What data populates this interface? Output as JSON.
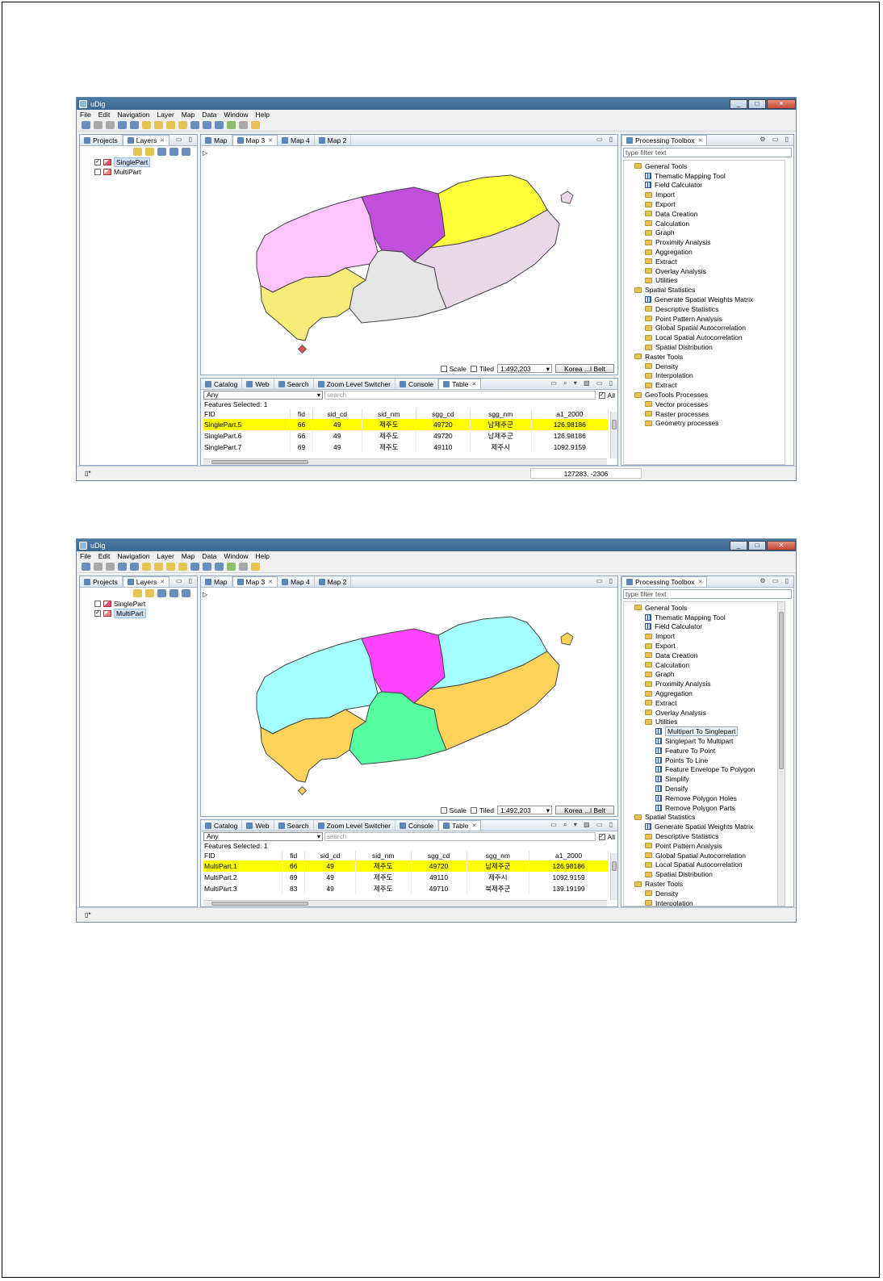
{
  "windows": [
    {
      "title": "uDig",
      "window_controls": [
        "_",
        "□",
        "✕"
      ],
      "menu": [
        "File",
        "Edit",
        "Navigation",
        "Layer",
        "Map",
        "Data",
        "Window",
        "Help"
      ],
      "left_tabs": [
        "Projects",
        "Layers"
      ],
      "layers": [
        {
          "name": "SinglePart",
          "checked": true,
          "selected": true
        },
        {
          "name": "MultiPart",
          "checked": false,
          "selected": false
        }
      ],
      "map_tabs": [
        "Map",
        "Map 3",
        "Map 4",
        "Map 2"
      ],
      "active_map_tab": 1,
      "map_colors": {
        "z1": "#ffc4ff",
        "z2": "#c050dc",
        "z3": "#ffff3a",
        "z4": "#ead8ea",
        "z5": "#e6e6e6",
        "z6": "#f6ec78",
        "islet": "#e05050"
      },
      "map_bottom": {
        "scale_label": "Scale",
        "tiled_label": "Tiled",
        "scale_value": "1:492,203",
        "crs_button": "Korea ...l Belt"
      },
      "bottom_tabs": [
        "Catalog",
        "Web",
        "Search",
        "Zoom Level Switcher",
        "Console",
        "Table"
      ],
      "filter_select": "Any",
      "search_placeholder": "search",
      "all_label": "All",
      "features_selected": "Features Selected: 1",
      "table_columns": [
        "FID",
        "fid",
        "sid_cd",
        "sid_nm",
        "sgg_cd",
        "sgg_nm",
        "a1_2000"
      ],
      "table_rows": [
        [
          "SinglePart.5",
          "66",
          "49",
          "제주도",
          "49720",
          "남제주군",
          "126.98186"
        ],
        [
          "SinglePart.6",
          "66",
          "49",
          "제주도",
          "49720",
          "남제주군",
          "126.98186"
        ],
        [
          "SinglePart.7",
          "69",
          "49",
          "제주도",
          "49110",
          "제주시",
          "1092.9159"
        ]
      ],
      "coords": "127283, -2306",
      "toolbox_title": "Processing Toolbox",
      "toolbox_filter": "type filter text",
      "toolbox_items": [
        {
          "l": 1,
          "t": "folder",
          "s": "General Tools"
        },
        {
          "l": 2,
          "t": "tool",
          "s": "Thematic Mapping Tool"
        },
        {
          "l": 2,
          "t": "tool",
          "s": "Field Calculator"
        },
        {
          "l": 2,
          "t": "folder",
          "s": "Import"
        },
        {
          "l": 2,
          "t": "folder",
          "s": "Export"
        },
        {
          "l": 2,
          "t": "folder",
          "s": "Data Creation"
        },
        {
          "l": 2,
          "t": "folder",
          "s": "Calculation"
        },
        {
          "l": 2,
          "t": "folder",
          "s": "Graph"
        },
        {
          "l": 2,
          "t": "folder",
          "s": "Proximity Analysis"
        },
        {
          "l": 2,
          "t": "folder",
          "s": "Aggregation"
        },
        {
          "l": 2,
          "t": "folder",
          "s": "Extract"
        },
        {
          "l": 2,
          "t": "folder",
          "s": "Overlay Analysis"
        },
        {
          "l": 2,
          "t": "folder",
          "s": "Utilities"
        },
        {
          "l": 1,
          "t": "folder",
          "s": "Spatial Statistics"
        },
        {
          "l": 2,
          "t": "tool",
          "s": "Generate Spatial Weights Matrix"
        },
        {
          "l": 2,
          "t": "folder",
          "s": "Descriptive Statistics"
        },
        {
          "l": 2,
          "t": "folder",
          "s": "Point Pattern Analysis"
        },
        {
          "l": 2,
          "t": "folder",
          "s": "Global Spatial Autocorrelation"
        },
        {
          "l": 2,
          "t": "folder",
          "s": "Local Spatial Autocorrelation"
        },
        {
          "l": 2,
          "t": "folder",
          "s": "Spatial Distribution"
        },
        {
          "l": 1,
          "t": "folder",
          "s": "Raster Tools"
        },
        {
          "l": 2,
          "t": "folder",
          "s": "Density"
        },
        {
          "l": 2,
          "t": "folder",
          "s": "Interpolation"
        },
        {
          "l": 2,
          "t": "folder",
          "s": "Extract"
        },
        {
          "l": 1,
          "t": "folder",
          "s": "GeoTools Processes"
        },
        {
          "l": 2,
          "t": "folder",
          "s": "Vector processes"
        },
        {
          "l": 2,
          "t": "folder",
          "s": "Raster processes"
        },
        {
          "l": 2,
          "t": "folder",
          "s": "Geometry processes"
        }
      ]
    },
    {
      "title": "uDig",
      "window_controls": [
        "_",
        "□",
        "✕"
      ],
      "menu": [
        "File",
        "Edit",
        "Navigation",
        "Layer",
        "Map",
        "Data",
        "Window",
        "Help"
      ],
      "left_tabs": [
        "Projects",
        "Layers"
      ],
      "layers": [
        {
          "name": "SinglePart",
          "checked": false,
          "selected": false
        },
        {
          "name": "MultiPart",
          "checked": true,
          "selected": true
        }
      ],
      "map_tabs": [
        "Map",
        "Map 3",
        "Map 4",
        "Map 2"
      ],
      "active_map_tab": 1,
      "map_colors": {
        "z1": "#a4ffff",
        "z2": "#ff44ff",
        "z3": "#a4ffff",
        "z4": "#ffd25a",
        "z5": "#55ffa0",
        "z6": "#ffd25a",
        "islet": "#ffd25a"
      },
      "map_bottom": {
        "scale_label": "Scale",
        "tiled_label": "Tiled",
        "scale_value": "1:492,203",
        "crs_button": "Korea ...l Belt"
      },
      "bottom_tabs": [
        "Catalog",
        "Web",
        "Search",
        "Zoom Level Switcher",
        "Console",
        "Table"
      ],
      "filter_select": "Any",
      "search_placeholder": "search",
      "all_label": "All",
      "features_selected": "Features Selected: 1",
      "table_columns": [
        "FID",
        "fid",
        "sid_cd",
        "sid_nm",
        "sgg_cd",
        "sgg_nm",
        "a1_2000"
      ],
      "table_rows": [
        [
          "MultiPart.1",
          "66",
          "49",
          "제주도",
          "49720",
          "남제주군",
          "126.98186"
        ],
        [
          "MultiPart.2",
          "69",
          "49",
          "제주도",
          "49110",
          "제주시",
          "1092.9159"
        ],
        [
          "MultiPart.3",
          "83",
          "49",
          "제주도",
          "49710",
          "북제주군",
          "139.19199"
        ]
      ],
      "coords": "",
      "toolbox_title": "Processing Toolbox",
      "toolbox_filter": "type filter text",
      "toolbox_items": [
        {
          "l": 1,
          "t": "folder",
          "s": "General Tools"
        },
        {
          "l": 2,
          "t": "tool",
          "s": "Thematic Mapping Tool"
        },
        {
          "l": 2,
          "t": "tool",
          "s": "Field Calculator"
        },
        {
          "l": 2,
          "t": "folder",
          "s": "Import"
        },
        {
          "l": 2,
          "t": "folder",
          "s": "Export"
        },
        {
          "l": 2,
          "t": "folder",
          "s": "Data Creation"
        },
        {
          "l": 2,
          "t": "folder",
          "s": "Calculation"
        },
        {
          "l": 2,
          "t": "folder",
          "s": "Graph"
        },
        {
          "l": 2,
          "t": "folder",
          "s": "Proximity Analysis"
        },
        {
          "l": 2,
          "t": "folder",
          "s": "Aggregation"
        },
        {
          "l": 2,
          "t": "folder",
          "s": "Extract"
        },
        {
          "l": 2,
          "t": "folder",
          "s": "Overlay Analysis"
        },
        {
          "l": 2,
          "t": "folder",
          "s": "Utilities"
        },
        {
          "l": 3,
          "t": "tool",
          "s": "Multipart To Singlepart",
          "sel": true
        },
        {
          "l": 3,
          "t": "tool",
          "s": "Singlepart To Multipart"
        },
        {
          "l": 3,
          "t": "tool",
          "s": "Feature To Point"
        },
        {
          "l": 3,
          "t": "tool",
          "s": "Points To Line"
        },
        {
          "l": 3,
          "t": "tool",
          "s": "Feature Envelope To Polygon"
        },
        {
          "l": 3,
          "t": "tool",
          "s": "Simplify"
        },
        {
          "l": 3,
          "t": "tool",
          "s": "Densify"
        },
        {
          "l": 3,
          "t": "tool",
          "s": "Remove Polygon Holes"
        },
        {
          "l": 3,
          "t": "tool",
          "s": "Remove Polygon Parts"
        },
        {
          "l": 1,
          "t": "folder",
          "s": "Spatial Statistics"
        },
        {
          "l": 2,
          "t": "tool",
          "s": "Generate Spatial Weights Matrix"
        },
        {
          "l": 2,
          "t": "folder",
          "s": "Descriptive Statistics"
        },
        {
          "l": 2,
          "t": "folder",
          "s": "Point Pattern Analysis"
        },
        {
          "l": 2,
          "t": "folder",
          "s": "Global Spatial Autocorrelation"
        },
        {
          "l": 2,
          "t": "folder",
          "s": "Local Spatial Autocorrelation"
        },
        {
          "l": 2,
          "t": "folder",
          "s": "Spatial Distribution"
        },
        {
          "l": 1,
          "t": "folder",
          "s": "Raster Tools"
        },
        {
          "l": 2,
          "t": "folder",
          "s": "Density"
        },
        {
          "l": 2,
          "t": "folder",
          "s": "Interpolation"
        }
      ]
    }
  ]
}
